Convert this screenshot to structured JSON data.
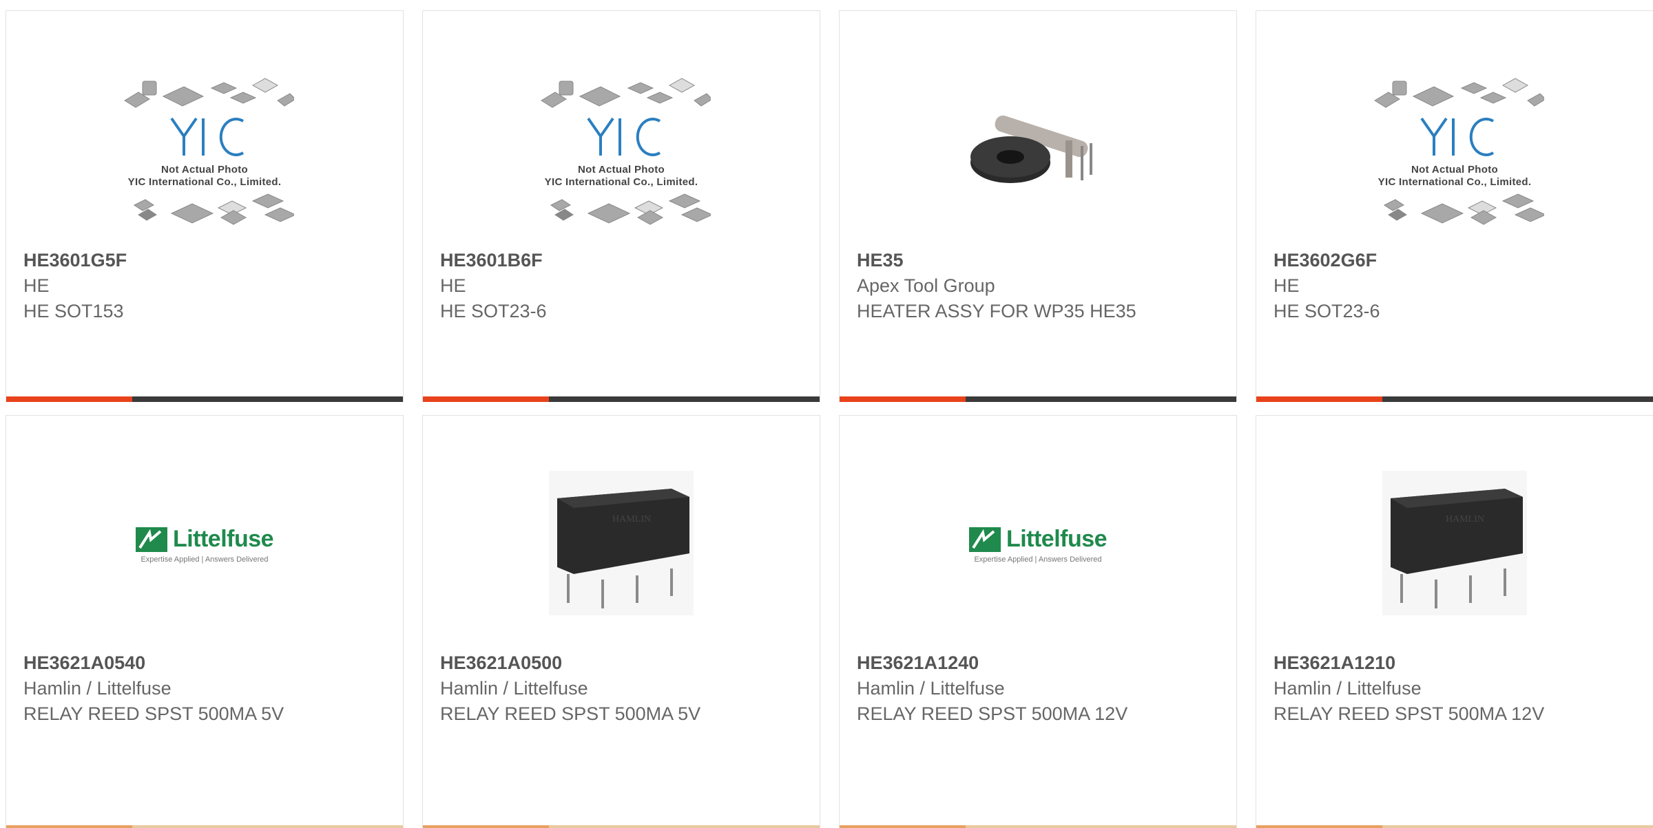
{
  "products": [
    {
      "pn": "HE3601G5F",
      "mfr": "HE",
      "desc": "HE SOT153",
      "image": "placeholder",
      "placeholder_lines": [
        "Not Actual Photo",
        "YIC International Co., Limited."
      ]
    },
    {
      "pn": "HE3601B6F",
      "mfr": "HE",
      "desc": "HE SOT23-6",
      "image": "placeholder",
      "placeholder_lines": [
        "Not Actual Photo",
        "YIC International Co., Limited."
      ]
    },
    {
      "pn": "HE35",
      "mfr": "Apex Tool Group",
      "desc": "HEATER ASSY FOR WP35 HE35",
      "image": "heater-photo"
    },
    {
      "pn": "HE3602G6F",
      "mfr": "HE",
      "desc": "HE SOT23-6",
      "image": "placeholder",
      "placeholder_lines": [
        "Not Actual Photo",
        "YIC International Co., Limited."
      ]
    },
    {
      "pn": "HE3621A0540",
      "mfr": "Hamlin / Littelfuse",
      "desc": "RELAY REED SPST 500MA 5V",
      "image": "littelfuse-logo",
      "logo_name": "Littelfuse",
      "logo_tag": "Expertise Applied | Answers Delivered"
    },
    {
      "pn": "HE3621A0500",
      "mfr": "Hamlin / Littelfuse",
      "desc": "RELAY REED SPST 500MA 5V",
      "image": "relay-photo",
      "photo_text": "HAMLIN"
    },
    {
      "pn": "HE3621A1240",
      "mfr": "Hamlin / Littelfuse",
      "desc": "RELAY REED SPST 500MA 12V",
      "image": "littelfuse-logo",
      "logo_name": "Littelfuse",
      "logo_tag": "Expertise Applied | Answers Delivered"
    },
    {
      "pn": "HE3621A1210",
      "mfr": "Hamlin / Littelfuse",
      "desc": "RELAY REED SPST 500MA 12V",
      "image": "relay-photo",
      "photo_text": "HAMLIN"
    }
  ],
  "colors": {
    "accent": "#e8421c",
    "bar": "#3a3a3a",
    "logo_green": "#1f8a4c",
    "logo_blue": "#2b7fc0"
  }
}
